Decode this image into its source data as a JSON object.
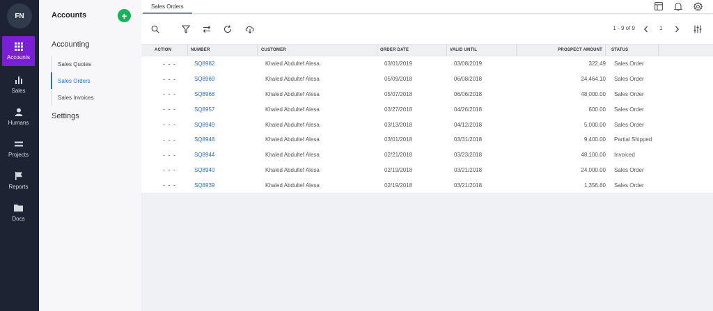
{
  "user": {
    "initials": "FN"
  },
  "rail": {
    "items": [
      {
        "label": "Accounts",
        "icon": "grid-icon",
        "active": true
      },
      {
        "label": "Sales",
        "icon": "bar-chart-icon"
      },
      {
        "label": "Humans",
        "icon": "person-icon"
      },
      {
        "label": "Projects",
        "icon": "equals-icon"
      },
      {
        "label": "Reports",
        "icon": "flag-icon"
      },
      {
        "label": "Docs",
        "icon": "folder-icon"
      }
    ]
  },
  "subnav": {
    "title": "Accounts",
    "add_label": "+",
    "group_accounting": "Accounting",
    "items": [
      {
        "label": "Sales Quotes"
      },
      {
        "label": "Sales Orders",
        "active": true
      },
      {
        "label": "Sales Invoices"
      }
    ],
    "group_settings": "Settings"
  },
  "tabs": [
    {
      "label": "Sales Orders"
    }
  ],
  "toolbar": {
    "pager_range": "1 - 9 of 9",
    "page": "1"
  },
  "table": {
    "headers": {
      "action": "ACTION",
      "number": "NUMBER",
      "customer": "CUSTOMER",
      "order_date": "ORDER DATE",
      "valid_until": "VALID UNTIL",
      "amount": "PROSPECT AMOUNT",
      "status": "STATUS"
    },
    "rows": [
      {
        "action": "- - -",
        "number": "SQ8982",
        "customer": "Khaled Abdultef Alesa",
        "order_date": "03/01/2019",
        "valid_until": "03/08/2019",
        "amount": "322.49",
        "status": "Sales Order"
      },
      {
        "action": "- - -",
        "number": "SQ8969",
        "customer": "Khaled Abdultef Alesa",
        "order_date": "05/09/2018",
        "valid_until": "06/08/2018",
        "amount": "24,464.10",
        "status": "Sales Order"
      },
      {
        "action": "- - -",
        "number": "SQ8968",
        "customer": "Khaled Abdultef Alesa",
        "order_date": "05/07/2018",
        "valid_until": "06/06/2018",
        "amount": "48,000.00",
        "status": "Sales Order"
      },
      {
        "action": "- - -",
        "number": "SQ8957",
        "customer": "Khaled Abdultef Alesa",
        "order_date": "03/27/2018",
        "valid_until": "04/26/2018",
        "amount": "600.00",
        "status": "Sales Order"
      },
      {
        "action": "- - -",
        "number": "SQ8949",
        "customer": "Khaled Abdultef Alesa",
        "order_date": "03/13/2018",
        "valid_until": "04/12/2018",
        "amount": "5,000.00",
        "status": "Sales Order"
      },
      {
        "action": "- - -",
        "number": "SQ8948",
        "customer": "Khaled Abdultef Alesa",
        "order_date": "03/01/2018",
        "valid_until": "03/31/2018",
        "amount": "9,400.00",
        "status": "Partial Shipped"
      },
      {
        "action": "- - -",
        "number": "SQ8944",
        "customer": "Khaled Abdultef Alesa",
        "order_date": "02/21/2018",
        "valid_until": "03/23/2018",
        "amount": "48,100.00",
        "status": "Invoiced"
      },
      {
        "action": "- - -",
        "number": "SQ8940",
        "customer": "Khaled Abdultef Alesa",
        "order_date": "02/19/2018",
        "valid_until": "03/21/2018",
        "amount": "24,000.00",
        "status": "Sales Order"
      },
      {
        "action": "- - -",
        "number": "SQ8939",
        "customer": "Khaled Abdultef Alesa",
        "order_date": "02/19/2018",
        "valid_until": "03/21/2018",
        "amount": "1,356.60",
        "status": "Sales Order"
      }
    ]
  },
  "colors": {
    "accent": "#7a1fd6",
    "link": "#2a6fc9",
    "add": "#18b25a",
    "rail_bg": "#1c2433"
  }
}
